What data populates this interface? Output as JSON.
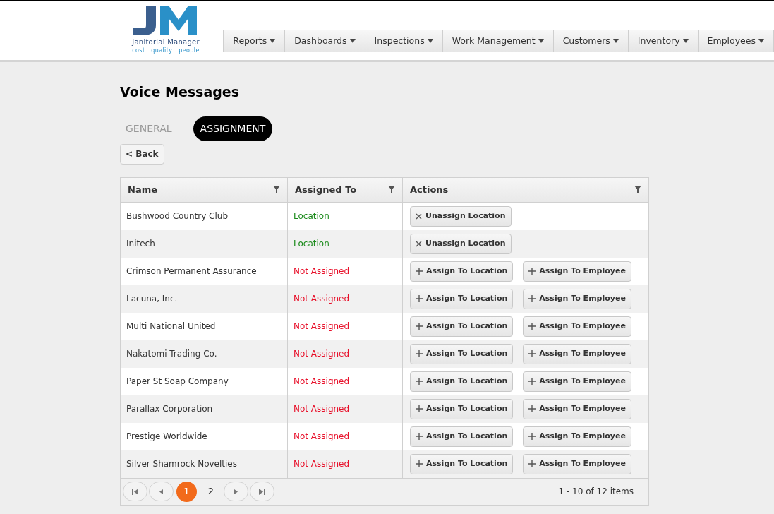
{
  "logo": {
    "title": "Janitorial Manager",
    "tagline": "cost . quality . people"
  },
  "nav": [
    {
      "label": "Reports"
    },
    {
      "label": "Dashboards"
    },
    {
      "label": "Inspections"
    },
    {
      "label": "Work Management"
    },
    {
      "label": "Customers"
    },
    {
      "label": "Inventory"
    },
    {
      "label": "Employees"
    }
  ],
  "page_title": "Voice Messages",
  "tabs": [
    {
      "label": "GENERAL",
      "selected": false
    },
    {
      "label": "ASSIGNMENT",
      "selected": true
    }
  ],
  "back_button": "< Back",
  "table": {
    "columns": [
      "Name",
      "Assigned To",
      "Actions"
    ],
    "rows": [
      {
        "name": "Bushwood Country Club",
        "assigned": "Location",
        "kind": "assigned",
        "actions": [
          {
            "kind": "remove",
            "label": "Unassign Location"
          }
        ]
      },
      {
        "name": "Initech",
        "assigned": "Location",
        "kind": "assigned",
        "actions": [
          {
            "kind": "remove",
            "label": "Unassign Location"
          }
        ]
      },
      {
        "name": "Crimson Permanent Assurance",
        "assigned": "Not Assigned",
        "kind": "unassigned",
        "actions": [
          {
            "kind": "add",
            "label": "Assign To Location"
          },
          {
            "kind": "add",
            "label": "Assign To Employee"
          }
        ]
      },
      {
        "name": "Lacuna, Inc.",
        "assigned": "Not Assigned",
        "kind": "unassigned",
        "actions": [
          {
            "kind": "add",
            "label": "Assign To Location"
          },
          {
            "kind": "add",
            "label": "Assign To Employee"
          }
        ]
      },
      {
        "name": "Multi National United",
        "assigned": "Not Assigned",
        "kind": "unassigned",
        "actions": [
          {
            "kind": "add",
            "label": "Assign To Location"
          },
          {
            "kind": "add",
            "label": "Assign To Employee"
          }
        ]
      },
      {
        "name": "Nakatomi Trading Co.",
        "assigned": "Not Assigned",
        "kind": "unassigned",
        "actions": [
          {
            "kind": "add",
            "label": "Assign To Location"
          },
          {
            "kind": "add",
            "label": "Assign To Employee"
          }
        ]
      },
      {
        "name": "Paper St Soap Company",
        "assigned": "Not Assigned",
        "kind": "unassigned",
        "actions": [
          {
            "kind": "add",
            "label": "Assign To Location"
          },
          {
            "kind": "add",
            "label": "Assign To Employee"
          }
        ]
      },
      {
        "name": "Parallax Corporation",
        "assigned": "Not Assigned",
        "kind": "unassigned",
        "actions": [
          {
            "kind": "add",
            "label": "Assign To Location"
          },
          {
            "kind": "add",
            "label": "Assign To Employee"
          }
        ]
      },
      {
        "name": "Prestige Worldwide",
        "assigned": "Not Assigned",
        "kind": "unassigned",
        "actions": [
          {
            "kind": "add",
            "label": "Assign To Location"
          },
          {
            "kind": "add",
            "label": "Assign To Employee"
          }
        ]
      },
      {
        "name": "Silver Shamrock Novelties",
        "assigned": "Not Assigned",
        "kind": "unassigned",
        "actions": [
          {
            "kind": "add",
            "label": "Assign To Location"
          },
          {
            "kind": "add",
            "label": "Assign To Employee"
          }
        ]
      }
    ]
  },
  "pager": {
    "pages": [
      {
        "label": "1",
        "selected": true
      },
      {
        "label": "2",
        "selected": false
      }
    ],
    "summary": "1 - 10 of 12 items"
  }
}
